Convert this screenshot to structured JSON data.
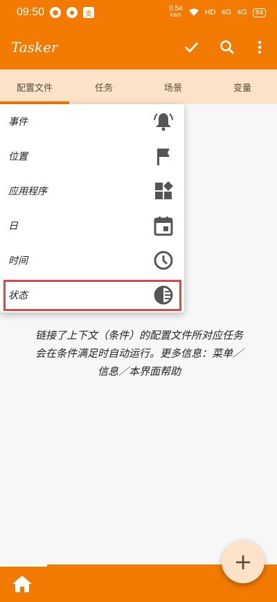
{
  "status_bar": {
    "time": "09:50",
    "net_speed_value": "0.54",
    "net_speed_unit": "KB/S",
    "hd": "HD",
    "sig1": "4G",
    "sig2": "4G",
    "battery": "84",
    "notif_icon3": "支"
  },
  "app_bar": {
    "title": "Tasker"
  },
  "tabs": [
    {
      "label": "配置文件"
    },
    {
      "label": "任务"
    },
    {
      "label": "场景"
    },
    {
      "label": "变量"
    }
  ],
  "menu": [
    {
      "label": "事件",
      "icon": "bell-icon"
    },
    {
      "label": "位置",
      "icon": "flag-icon"
    },
    {
      "label": "应用程序",
      "icon": "apps-icon"
    },
    {
      "label": "日",
      "icon": "calendar-icon"
    },
    {
      "label": "时间",
      "icon": "clock-icon"
    },
    {
      "label": "状态",
      "icon": "contrast-icon"
    }
  ],
  "hint_line1": "链接了上下文（条件）的配置文件所对应任务",
  "hint_line2": "会在条件满足时自动运行。更多信息：菜单／",
  "hint_line3": "信息／本界面帮助",
  "fab": {
    "symbol": "+"
  },
  "colors": {
    "accent": "#f27a00",
    "tab_bg": "#fbe2c8",
    "highlight": "#d9474a"
  }
}
